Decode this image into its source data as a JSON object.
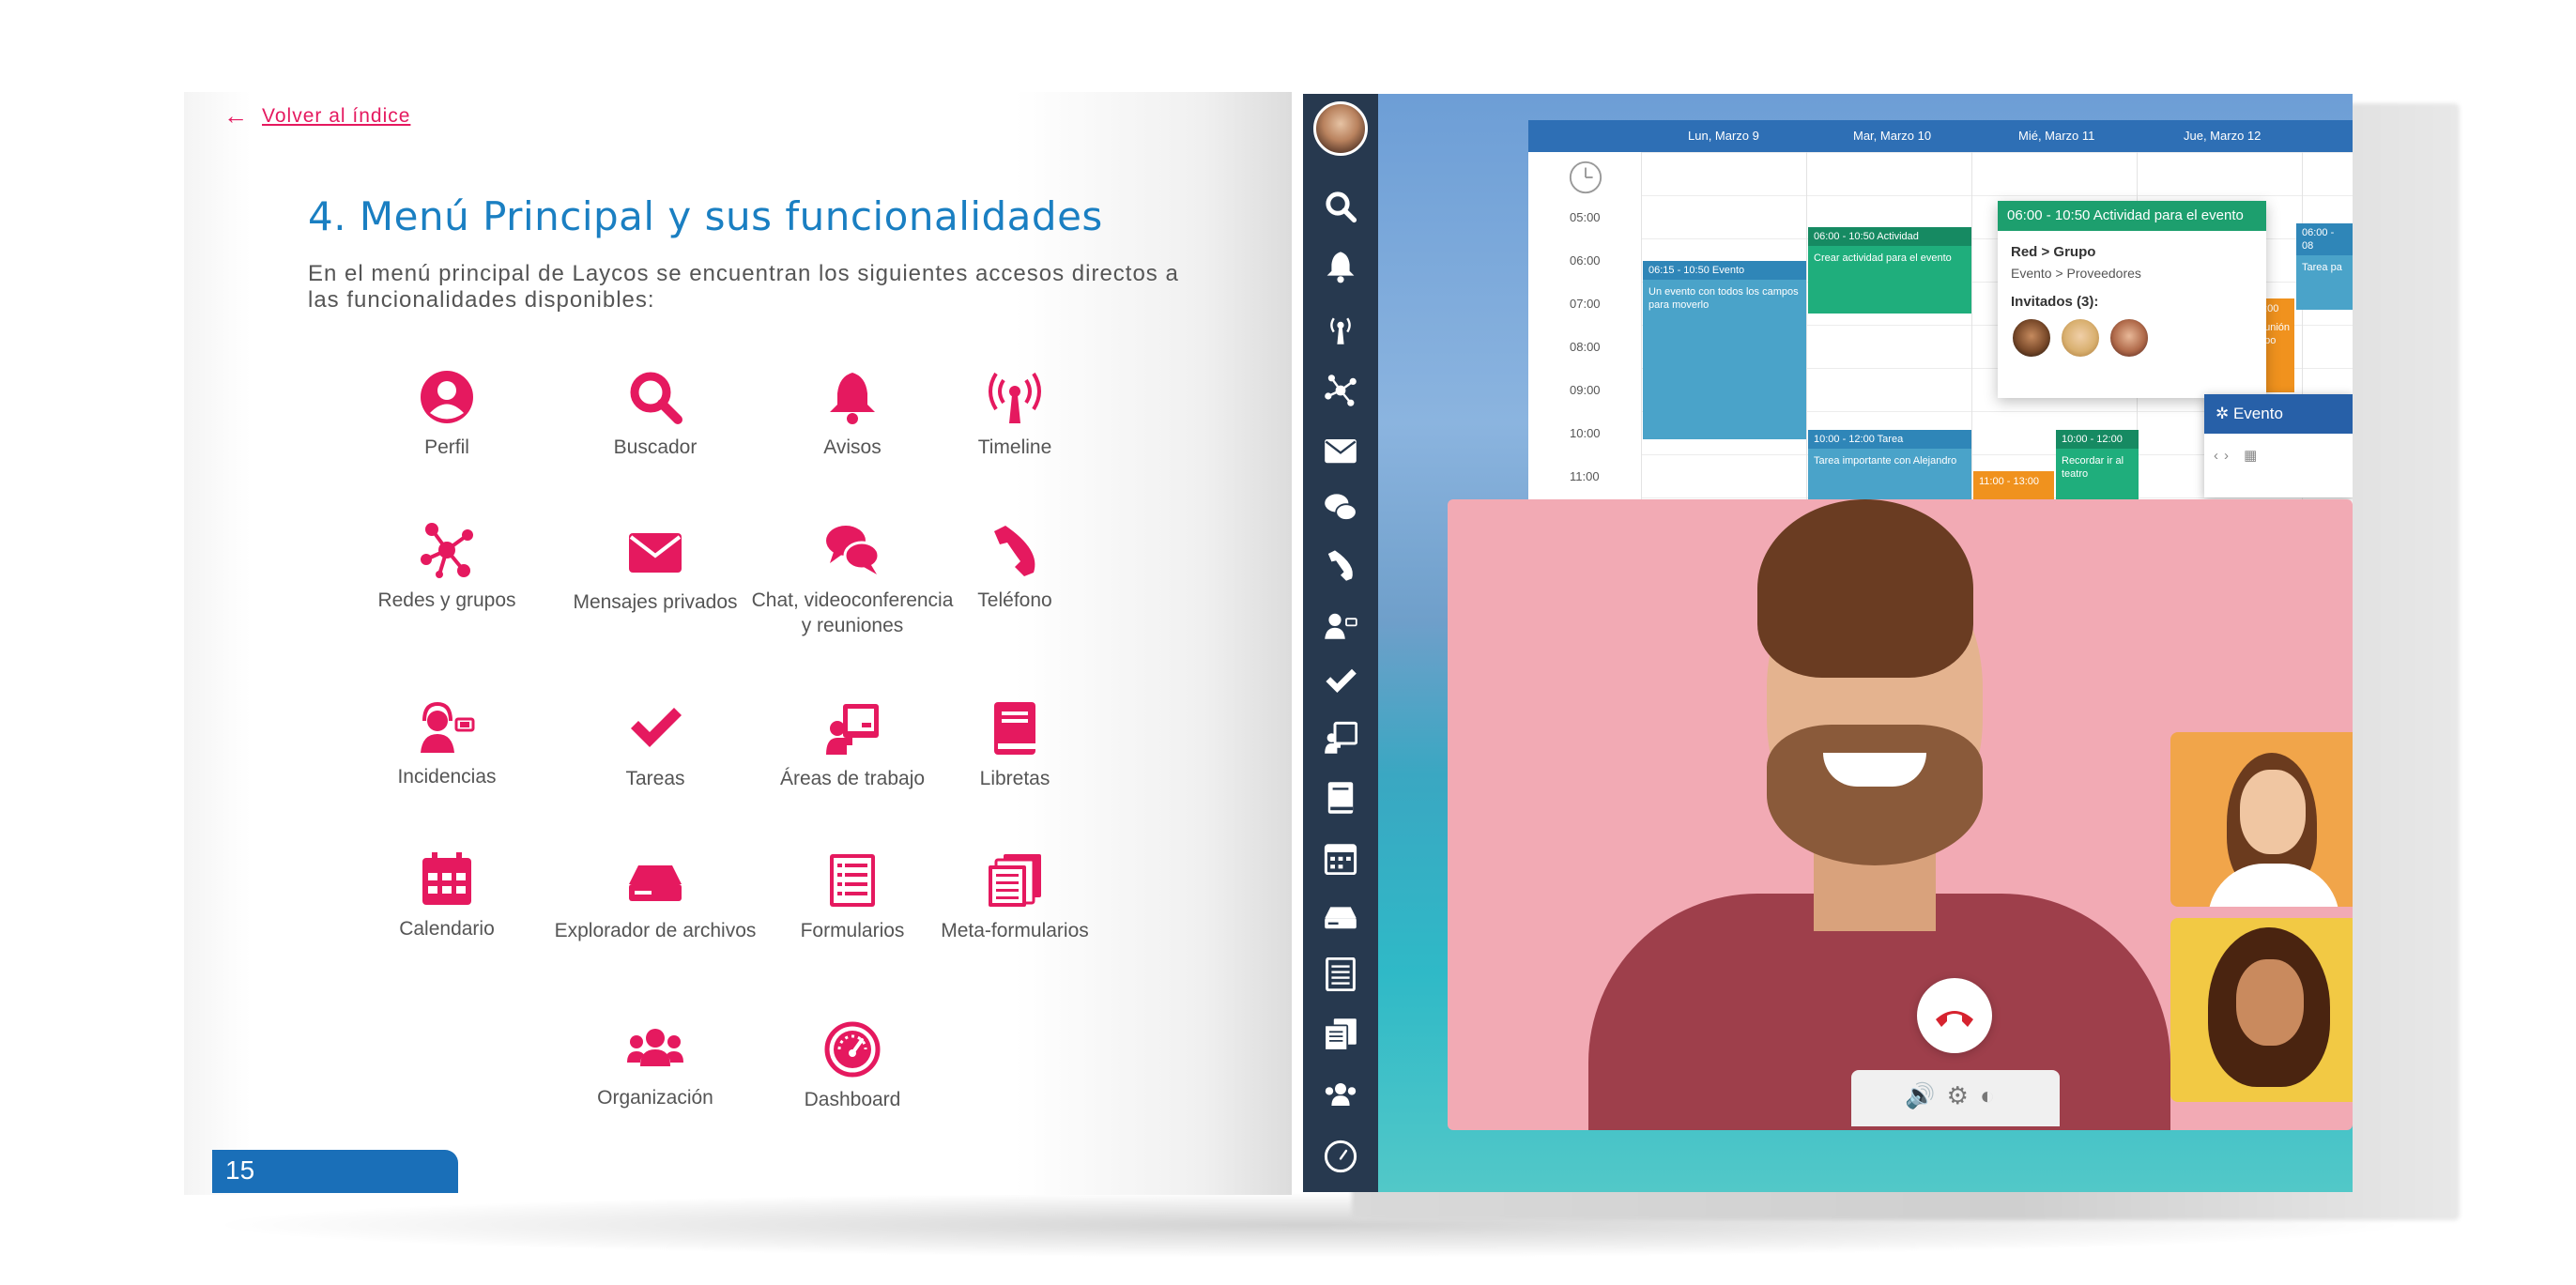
{
  "left_page": {
    "back_link": "Volver al índice",
    "title": "4. Menú Principal y sus funcionalidades",
    "intro": "En el menú principal de Laycos se encuentran los siguientes accesos directos a las funcionalidades disponibles:",
    "icons": [
      {
        "label": "Perfil",
        "icon": "user-circle-icon"
      },
      {
        "label": "Buscador",
        "icon": "search-icon"
      },
      {
        "label": "Avisos",
        "icon": "bell-icon"
      },
      {
        "label": "Timeline",
        "icon": "broadcast-tower-icon"
      },
      {
        "label": "Redes y grupos",
        "icon": "network-icon"
      },
      {
        "label": "Mensajes privados",
        "icon": "envelope-icon"
      },
      {
        "label": "Chat, videoconferencia y reuniones",
        "icon": "chat-bubbles-icon"
      },
      {
        "label": "Teléfono",
        "icon": "phone-icon"
      },
      {
        "label": "Incidencias",
        "icon": "support-agent-icon"
      },
      {
        "label": "Tareas",
        "icon": "checkmark-icon"
      },
      {
        "label": "Áreas de trabajo",
        "icon": "presentation-icon"
      },
      {
        "label": "Libretas",
        "icon": "book-icon"
      },
      {
        "label": "Calendario",
        "icon": "calendar-icon"
      },
      {
        "label": "Explorador de archivos",
        "icon": "hard-drive-icon"
      },
      {
        "label": "Formularios",
        "icon": "form-icon"
      },
      {
        "label": "Meta-formularios",
        "icon": "multi-form-icon"
      },
      {
        "label": "Organización",
        "icon": "users-group-icon"
      },
      {
        "label": "Dashboard",
        "icon": "gauge-icon"
      }
    ],
    "page_number": "15"
  },
  "right_page": {
    "calendar": {
      "days": [
        "Lun, Marzo 9",
        "Mar, Marzo 10",
        "Mié, Marzo 11",
        "Jue, Marzo 12"
      ],
      "times": [
        "05:00",
        "06:00",
        "07:00",
        "08:00",
        "09:00",
        "10:00",
        "11:00"
      ],
      "events": [
        {
          "time": "06:15 - 10:50 Evento",
          "text": "Un evento con todos los campos para moverlo"
        },
        {
          "time": "06:00 - 10:50 Actividad",
          "text": "Crear actividad para el evento"
        },
        {
          "time": "10:00 - 12:00 Tarea",
          "text": "Tarea importante con Alejandro"
        },
        {
          "time": "10:00 - 12:00",
          "text": "Recordar ir al teatro"
        },
        {
          "time": "11:00 - 13:00",
          "text": ""
        },
        {
          "time": "06:00 - 08",
          "text": "Tarea pa"
        },
        {
          "time": "7:00",
          "text": "eunión upo"
        }
      ],
      "popup": {
        "header": "06:00 - 10:50 Actividad para el evento",
        "line1": "Red > Grupo",
        "line2": "Evento > Proveedores",
        "line3": "Invitados (3):"
      },
      "evento_panel": "Evento"
    },
    "colors": {
      "accent": "#e5195f",
      "blue": "#1a7fc2",
      "sidebar": "#27394f",
      "green": "#1d9f6e",
      "teal_event": "#4aa3c9",
      "orange_event": "#f0921e"
    }
  }
}
